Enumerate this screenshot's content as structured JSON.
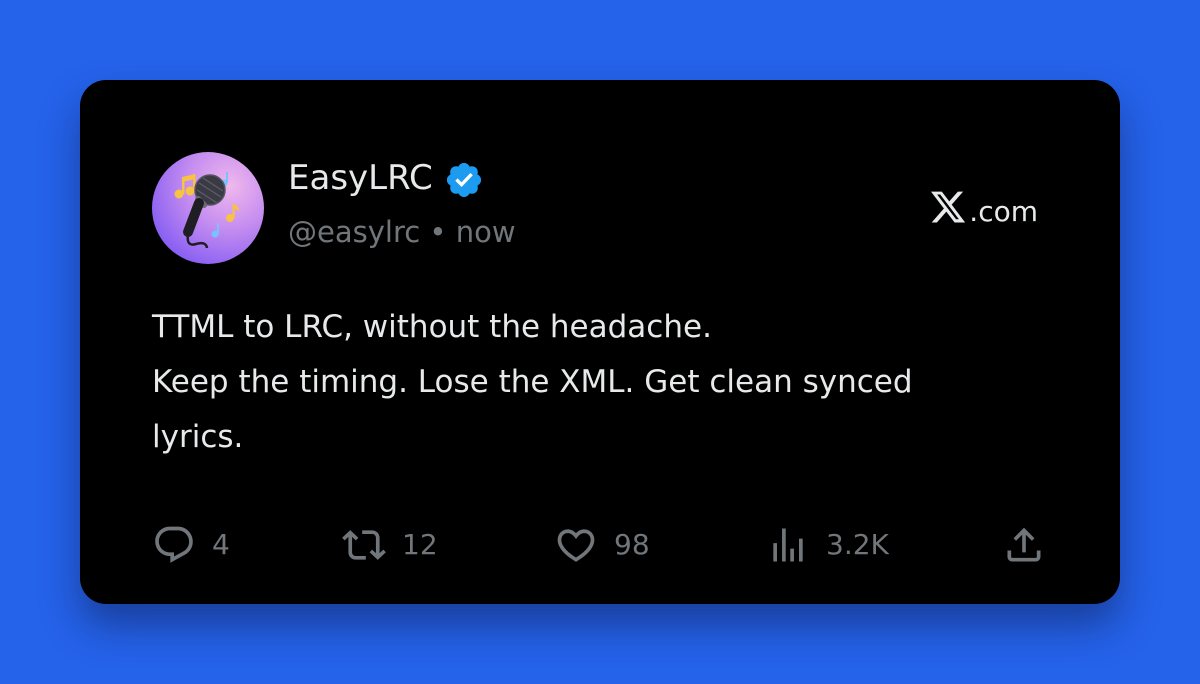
{
  "post": {
    "author_name": "EasyLRC",
    "handle": "@easylrc",
    "separator": "•",
    "time": "now",
    "brand_suffix": ".com",
    "lines": [
      "TTML to LRC, without the headache.",
      "Keep the timing. Lose the XML. Get clean synced",
      "lyrics."
    ]
  },
  "actions": {
    "replies": "4",
    "reposts": "12",
    "likes": "98",
    "views": "3.2K"
  },
  "colors": {
    "background": "#2563eb",
    "card": "#000000",
    "primary_text": "#e7e9ea",
    "secondary_text": "#71767b",
    "verified_badge": "#1d9bf0"
  },
  "icons": [
    "microphone-avatar",
    "verified-badge-icon",
    "x-logo-icon",
    "reply-icon",
    "repost-icon",
    "like-icon",
    "views-icon",
    "share-icon"
  ]
}
